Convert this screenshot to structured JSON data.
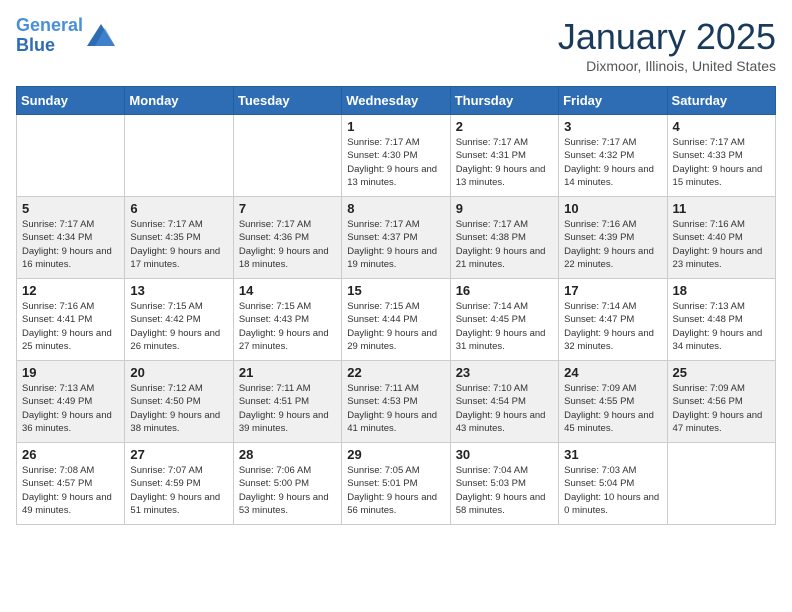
{
  "logo": {
    "line1": "General",
    "line2": "Blue"
  },
  "header": {
    "month": "January 2025",
    "location": "Dixmoor, Illinois, United States"
  },
  "weekdays": [
    "Sunday",
    "Monday",
    "Tuesday",
    "Wednesday",
    "Thursday",
    "Friday",
    "Saturday"
  ],
  "weeks": [
    [
      {
        "day": "",
        "detail": ""
      },
      {
        "day": "",
        "detail": ""
      },
      {
        "day": "",
        "detail": ""
      },
      {
        "day": "1",
        "detail": "Sunrise: 7:17 AM\nSunset: 4:30 PM\nDaylight: 9 hours and 13 minutes."
      },
      {
        "day": "2",
        "detail": "Sunrise: 7:17 AM\nSunset: 4:31 PM\nDaylight: 9 hours and 13 minutes."
      },
      {
        "day": "3",
        "detail": "Sunrise: 7:17 AM\nSunset: 4:32 PM\nDaylight: 9 hours and 14 minutes."
      },
      {
        "day": "4",
        "detail": "Sunrise: 7:17 AM\nSunset: 4:33 PM\nDaylight: 9 hours and 15 minutes."
      }
    ],
    [
      {
        "day": "5",
        "detail": "Sunrise: 7:17 AM\nSunset: 4:34 PM\nDaylight: 9 hours and 16 minutes."
      },
      {
        "day": "6",
        "detail": "Sunrise: 7:17 AM\nSunset: 4:35 PM\nDaylight: 9 hours and 17 minutes."
      },
      {
        "day": "7",
        "detail": "Sunrise: 7:17 AM\nSunset: 4:36 PM\nDaylight: 9 hours and 18 minutes."
      },
      {
        "day": "8",
        "detail": "Sunrise: 7:17 AM\nSunset: 4:37 PM\nDaylight: 9 hours and 19 minutes."
      },
      {
        "day": "9",
        "detail": "Sunrise: 7:17 AM\nSunset: 4:38 PM\nDaylight: 9 hours and 21 minutes."
      },
      {
        "day": "10",
        "detail": "Sunrise: 7:16 AM\nSunset: 4:39 PM\nDaylight: 9 hours and 22 minutes."
      },
      {
        "day": "11",
        "detail": "Sunrise: 7:16 AM\nSunset: 4:40 PM\nDaylight: 9 hours and 23 minutes."
      }
    ],
    [
      {
        "day": "12",
        "detail": "Sunrise: 7:16 AM\nSunset: 4:41 PM\nDaylight: 9 hours and 25 minutes."
      },
      {
        "day": "13",
        "detail": "Sunrise: 7:15 AM\nSunset: 4:42 PM\nDaylight: 9 hours and 26 minutes."
      },
      {
        "day": "14",
        "detail": "Sunrise: 7:15 AM\nSunset: 4:43 PM\nDaylight: 9 hours and 27 minutes."
      },
      {
        "day": "15",
        "detail": "Sunrise: 7:15 AM\nSunset: 4:44 PM\nDaylight: 9 hours and 29 minutes."
      },
      {
        "day": "16",
        "detail": "Sunrise: 7:14 AM\nSunset: 4:45 PM\nDaylight: 9 hours and 31 minutes."
      },
      {
        "day": "17",
        "detail": "Sunrise: 7:14 AM\nSunset: 4:47 PM\nDaylight: 9 hours and 32 minutes."
      },
      {
        "day": "18",
        "detail": "Sunrise: 7:13 AM\nSunset: 4:48 PM\nDaylight: 9 hours and 34 minutes."
      }
    ],
    [
      {
        "day": "19",
        "detail": "Sunrise: 7:13 AM\nSunset: 4:49 PM\nDaylight: 9 hours and 36 minutes."
      },
      {
        "day": "20",
        "detail": "Sunrise: 7:12 AM\nSunset: 4:50 PM\nDaylight: 9 hours and 38 minutes."
      },
      {
        "day": "21",
        "detail": "Sunrise: 7:11 AM\nSunset: 4:51 PM\nDaylight: 9 hours and 39 minutes."
      },
      {
        "day": "22",
        "detail": "Sunrise: 7:11 AM\nSunset: 4:53 PM\nDaylight: 9 hours and 41 minutes."
      },
      {
        "day": "23",
        "detail": "Sunrise: 7:10 AM\nSunset: 4:54 PM\nDaylight: 9 hours and 43 minutes."
      },
      {
        "day": "24",
        "detail": "Sunrise: 7:09 AM\nSunset: 4:55 PM\nDaylight: 9 hours and 45 minutes."
      },
      {
        "day": "25",
        "detail": "Sunrise: 7:09 AM\nSunset: 4:56 PM\nDaylight: 9 hours and 47 minutes."
      }
    ],
    [
      {
        "day": "26",
        "detail": "Sunrise: 7:08 AM\nSunset: 4:57 PM\nDaylight: 9 hours and 49 minutes."
      },
      {
        "day": "27",
        "detail": "Sunrise: 7:07 AM\nSunset: 4:59 PM\nDaylight: 9 hours and 51 minutes."
      },
      {
        "day": "28",
        "detail": "Sunrise: 7:06 AM\nSunset: 5:00 PM\nDaylight: 9 hours and 53 minutes."
      },
      {
        "day": "29",
        "detail": "Sunrise: 7:05 AM\nSunset: 5:01 PM\nDaylight: 9 hours and 56 minutes."
      },
      {
        "day": "30",
        "detail": "Sunrise: 7:04 AM\nSunset: 5:03 PM\nDaylight: 9 hours and 58 minutes."
      },
      {
        "day": "31",
        "detail": "Sunrise: 7:03 AM\nSunset: 5:04 PM\nDaylight: 10 hours and 0 minutes."
      },
      {
        "day": "",
        "detail": ""
      }
    ]
  ]
}
